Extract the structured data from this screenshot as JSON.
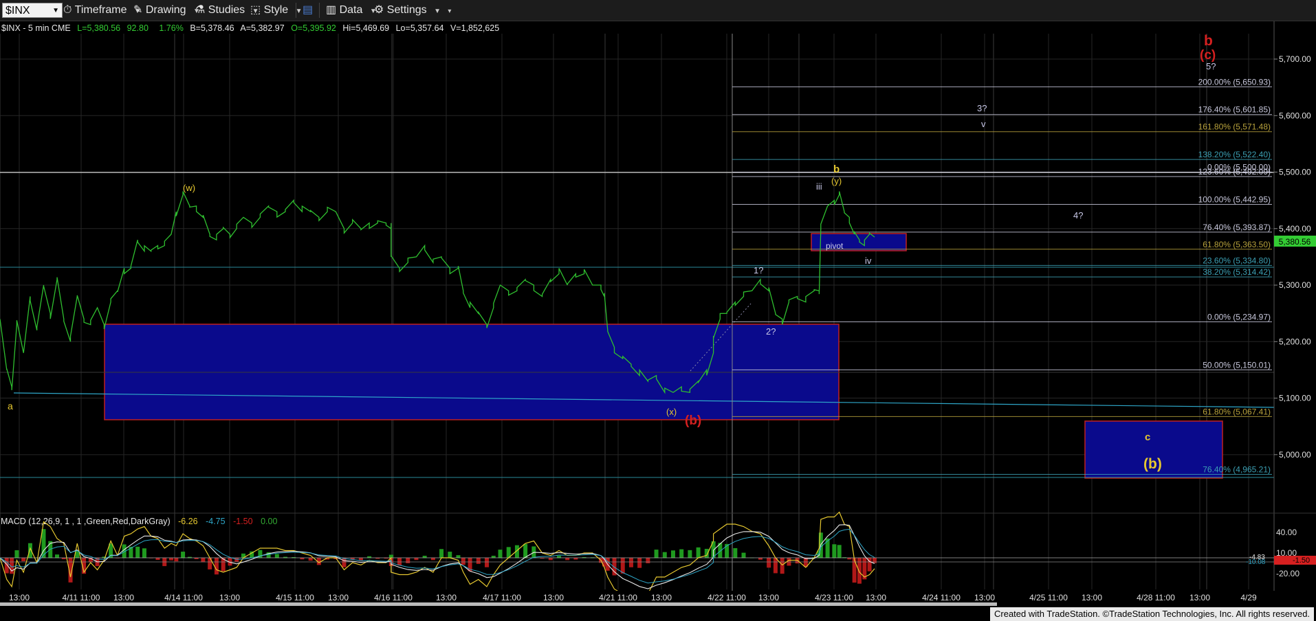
{
  "toolbar": {
    "symbol": "$INX",
    "timeframe": "Timeframe",
    "drawing": "Drawing",
    "studies": "Studies",
    "style": "Style",
    "data": "Data",
    "settings": "Settings"
  },
  "header": {
    "title": "$INX - 5 min  CME",
    "last": "L=5,380.56",
    "change": "92.80",
    "pct": "1.76%",
    "bid": "B=5,378.46",
    "ask": "A=5,382.97",
    "open": "O=5,395.92",
    "high": "Hi=5,469.69",
    "low": "Lo=5,357.64",
    "volume": "V=1,852,625"
  },
  "price_axis": {
    "ticks": [
      "5,700.00",
      "5,600.00",
      "5,500.00",
      "5,400.00",
      "5,300.00",
      "5,200.00",
      "5,100.00",
      "5,000.00"
    ],
    "last_price": "5,380.56",
    "last_color": "#33cc33"
  },
  "time_axis": [
    "13:00",
    "4/11 11:00",
    "13:00",
    "4/14 11:00",
    "13:00",
    "4/15 11:00",
    "13:00",
    "4/16 11:00",
    "13:00",
    "4/17 11:00",
    "13:00",
    "4/21 11:00",
    "13:00",
    "4/22 11:00",
    "13:00",
    "4/23 11:00",
    "13:00",
    "4/24 11:00",
    "13:00",
    "4/25 11:00",
    "13:00",
    "4/28 11:00",
    "13:00",
    "4/29"
  ],
  "fib_levels": [
    {
      "label": "200.00% (5,650.93)",
      "color": "#c8c8dc"
    },
    {
      "label": "176.40% (5,601.85)",
      "color": "#c8c8dc"
    },
    {
      "label": "161.80% (5,571.48)",
      "color": "#b8a23c"
    },
    {
      "label": "138.20% (5,522.40)",
      "color": "#3ca0b4"
    },
    {
      "label": "0.00% (5,500.00)",
      "color": "#c8c8dc"
    },
    {
      "label": "123.60% (5,492.09)",
      "color": "#c8c8dc"
    },
    {
      "label": "100.00% (5,442.95)",
      "color": "#c8c8dc"
    },
    {
      "label": "76.40% (5,393.87)",
      "color": "#c8c8dc"
    },
    {
      "label": "61.80% (5,363.50)",
      "color": "#b8a23c"
    },
    {
      "label": "23.60% (5,334.80)",
      "color": "#3ca0b4"
    },
    {
      "label": "38.20% (5,314.42)",
      "color": "#3ca0b4"
    },
    {
      "label": "0.00% (5,234.97)",
      "color": "#c8c8dc"
    },
    {
      "label": "50.00% (5,150.01)",
      "color": "#c8c8dc"
    },
    {
      "label": "61.80% (5,067.41)",
      "color": "#b8a23c"
    },
    {
      "label": "76.40% (4,965.21)",
      "color": "#3ca0b4"
    }
  ],
  "wave_labels": {
    "a": "a",
    "w": "(w)",
    "x": "(x)",
    "b_red": "(b)",
    "one": "1?",
    "two": "2?",
    "iii": "iii",
    "y": "(y)",
    "b_yellow": "b",
    "iv": "iv",
    "pivot": "pivot",
    "three": "3?",
    "v": "v",
    "four": "4?",
    "five": "5?",
    "b_top": "b",
    "c_top": "(c)",
    "c_target": "c",
    "b_target": "(b)"
  },
  "macd": {
    "title": "MACD (12,26,9, 1 , 1 ,Green,Red,DarkGray)",
    "v1": "-6.26",
    "v2": "-4.75",
    "v3": "-1.50",
    "v4": "0.00",
    "axis": [
      "40.00",
      "10.00",
      "-20.00"
    ],
    "badge1": "-1.50",
    "badge2": "-4.83",
    "badge3": "-10.08"
  },
  "footer": "Created with TradeStation. ©TradeStation Technologies, Inc. All rights reserved.",
  "chart_data": {
    "type": "line",
    "series": [
      {
        "values": [
          [
            0,
            5240
          ],
          [
            8,
            5150
          ],
          [
            14,
            5120
          ],
          [
            20,
            5230
          ],
          [
            28,
            5180
          ],
          [
            36,
            5280
          ],
          [
            44,
            5220
          ],
          [
            52,
            5300
          ],
          [
            60,
            5250
          ],
          [
            68,
            5310
          ],
          [
            76,
            5240
          ],
          [
            84,
            5200
          ],
          [
            92,
            5280
          ],
          [
            100,
            5240
          ],
          [
            108,
            5230
          ],
          [
            116,
            5260
          ],
          [
            124,
            5230
          ],
          [
            132,
            5270
          ],
          [
            140,
            5290
          ],
          [
            148,
            5330
          ],
          [
            156,
            5330
          ],
          [
            164,
            5380
          ],
          [
            172,
            5360
          ],
          [
            180,
            5360
          ],
          [
            188,
            5370
          ],
          [
            196,
            5370
          ],
          [
            204,
            5390
          ],
          [
            210,
            5430
          ],
          [
            218,
            5460
          ],
          [
            226,
            5440
          ],
          [
            234,
            5440
          ],
          [
            242,
            5420
          ],
          [
            250,
            5390
          ],
          [
            258,
            5380
          ],
          [
            266,
            5400
          ],
          [
            274,
            5390
          ],
          [
            282,
            5400
          ],
          [
            290,
            5420
          ],
          [
            300,
            5410
          ],
          [
            310,
            5420
          ],
          [
            320,
            5440
          ],
          [
            330,
            5430
          ],
          [
            340,
            5430
          ],
          [
            350,
            5450
          ],
          [
            360,
            5430
          ],
          [
            370,
            5430
          ],
          [
            380,
            5420
          ],
          [
            390,
            5430
          ],
          [
            400,
            5430
          ],
          [
            410,
            5400
          ],
          [
            420,
            5410
          ],
          [
            430,
            5400
          ],
          [
            440,
            5410
          ],
          [
            450,
            5410
          ],
          [
            460,
            5410
          ],
          [
            466,
            5400
          ],
          [
            466,
            5350
          ],
          [
            476,
            5330
          ],
          [
            486,
            5340
          ],
          [
            496,
            5350
          ],
          [
            506,
            5370
          ],
          [
            516,
            5340
          ],
          [
            526,
            5350
          ],
          [
            536,
            5330
          ],
          [
            546,
            5330
          ],
          [
            552,
            5290
          ],
          [
            560,
            5260
          ],
          [
            570,
            5250
          ],
          [
            580,
            5230
          ],
          [
            588,
            5260
          ],
          [
            596,
            5300
          ],
          [
            606,
            5290
          ],
          [
            616,
            5290
          ],
          [
            626,
            5310
          ],
          [
            636,
            5300
          ],
          [
            646,
            5280
          ],
          [
            656,
            5310
          ],
          [
            666,
            5320
          ],
          [
            676,
            5300
          ],
          [
            686,
            5320
          ],
          [
            696,
            5320
          ],
          [
            706,
            5300
          ],
          [
            716,
            5300
          ],
          [
            720,
            5280
          ],
          [
            724,
            5220
          ],
          [
            732,
            5190
          ],
          [
            742,
            5170
          ],
          [
            752,
            5160
          ],
          [
            762,
            5140
          ],
          [
            772,
            5130
          ],
          [
            782,
            5140
          ],
          [
            792,
            5110
          ],
          [
            802,
            5110
          ],
          [
            812,
            5120
          ],
          [
            822,
            5110
          ],
          [
            832,
            5130
          ],
          [
            842,
            5150
          ],
          [
            850,
            5180
          ],
          [
            850,
            5210
          ],
          [
            858,
            5240
          ],
          [
            866,
            5250
          ],
          [
            876,
            5270
          ],
          [
            886,
            5280
          ],
          [
            896,
            5290
          ],
          [
            906,
            5310
          ],
          [
            916,
            5290
          ],
          [
            924,
            5250
          ],
          [
            932,
            5240
          ],
          [
            940,
            5270
          ],
          [
            950,
            5280
          ],
          [
            960,
            5270
          ],
          [
            970,
            5290
          ],
          [
            976,
            5290
          ],
          [
            978,
            5400
          ],
          [
            986,
            5440
          ],
          [
            994,
            5450
          ],
          [
            1000,
            5460
          ],
          [
            1006,
            5430
          ],
          [
            1012,
            5420
          ],
          [
            1018,
            5390
          ],
          [
            1024,
            5380
          ],
          [
            1030,
            5370
          ],
          [
            1036,
            5390
          ],
          [
            1042,
            5385
          ]
        ]
      }
    ],
    "xlim": [
      0,
      1518
    ],
    "ylim": [
      4895,
      5755
    ],
    "grid": true
  }
}
